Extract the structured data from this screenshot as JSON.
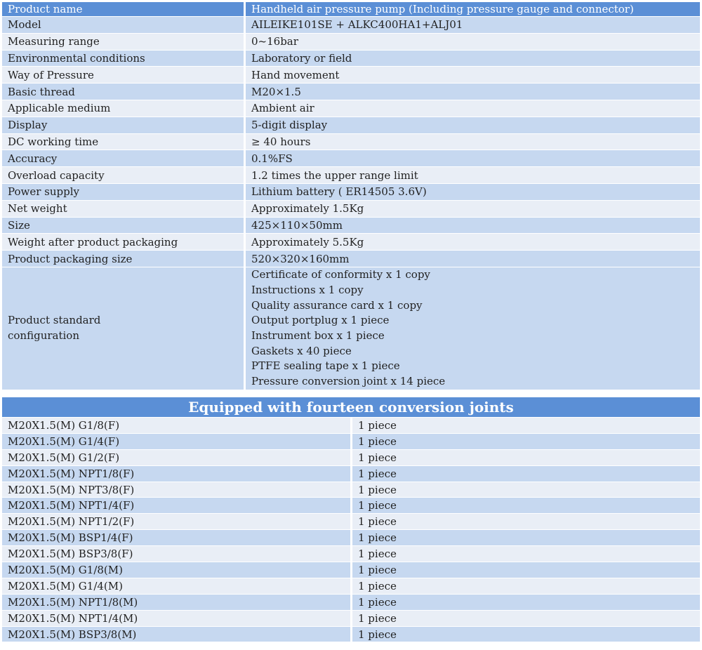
{
  "spec_table": {
    "header": {
      "label": "Product name",
      "value": "Handheld air pressure pump (Including pressure gauge and connector)"
    },
    "rows": [
      {
        "label": "Model",
        "value": "AILEIKE101SE + ALKC400HA1+ALJ01"
      },
      {
        "label": "Measuring range",
        "value": "0~16bar"
      },
      {
        "label": "Environmental conditions",
        "value": "Laboratory or field"
      },
      {
        "label": "Way of Pressure",
        "value": "Hand movement"
      },
      {
        "label": "Basic thread",
        "value": "M20×1.5"
      },
      {
        "label": "Applicable medium",
        "value": "Ambient air"
      },
      {
        "label": "Display",
        "value": "5-digit display"
      },
      {
        "label": "DC working time",
        "value": "≥ 40 hours"
      },
      {
        "label": "Accuracy",
        "value": "0.1%FS"
      },
      {
        "label": "Overload capacity",
        "value": "1.2 times the upper range limit"
      },
      {
        "label": "Power supply",
        "value": "Lithium battery ( ER14505 3.6V)"
      },
      {
        "label": "Net weight",
        "value": "Approximately 1.5Kg"
      },
      {
        "label": "Size",
        "value": "425×110×50mm"
      },
      {
        "label": "Weight after product packaging",
        "value": "Approximately 5.5Kg"
      },
      {
        "label": "Product packaging size",
        "value": "520×320×160mm"
      }
    ],
    "configuration": {
      "label_line1": "Product standard",
      "label_line2": "configuration",
      "items": [
        "Certificate of conformity x 1 copy",
        "Instructions x 1 copy",
        "Quality assurance card x 1 copy",
        "Output portplug x 1 piece",
        "Instrument box x 1 piece",
        "Gaskets x 40 piece",
        "PTFE sealing tape x 1 piece",
        "Pressure conversion joint x 14 piece"
      ]
    }
  },
  "joints_table": {
    "title": "Equipped with fourteen conversion joints",
    "rows": [
      {
        "name": "M20X1.5(M) G1/8(F)",
        "qty": "1 piece"
      },
      {
        "name": "M20X1.5(M) G1/4(F)",
        "qty": "1 piece"
      },
      {
        "name": "M20X1.5(M) G1/2(F)",
        "qty": "1 piece"
      },
      {
        "name": "M20X1.5(M) NPT1/8(F)",
        "qty": "1 piece"
      },
      {
        "name": "M20X1.5(M) NPT3/8(F)",
        "qty": "1 piece"
      },
      {
        "name": "M20X1.5(M) NPT1/4(F)",
        "qty": "1 piece"
      },
      {
        "name": "M20X1.5(M) NPT1/2(F)",
        "qty": "1 piece"
      },
      {
        "name": "M20X1.5(M) BSP1/4(F)",
        "qty": "1 piece"
      },
      {
        "name": "M20X1.5(M) BSP3/8(F)",
        "qty": "1 piece"
      },
      {
        "name": "M20X1.5(M) G1/8(M)",
        "qty": "1 piece"
      },
      {
        "name": "M20X1.5(M) G1/4(M)",
        "qty": "1 piece"
      },
      {
        "name": "M20X1.5(M) NPT1/8(M)",
        "qty": "1 piece"
      },
      {
        "name": "M20X1.5(M) NPT1/4(M)",
        "qty": "1 piece"
      },
      {
        "name": "M20X1.5(M) BSP3/8(M)",
        "qty": "1 piece"
      }
    ]
  }
}
